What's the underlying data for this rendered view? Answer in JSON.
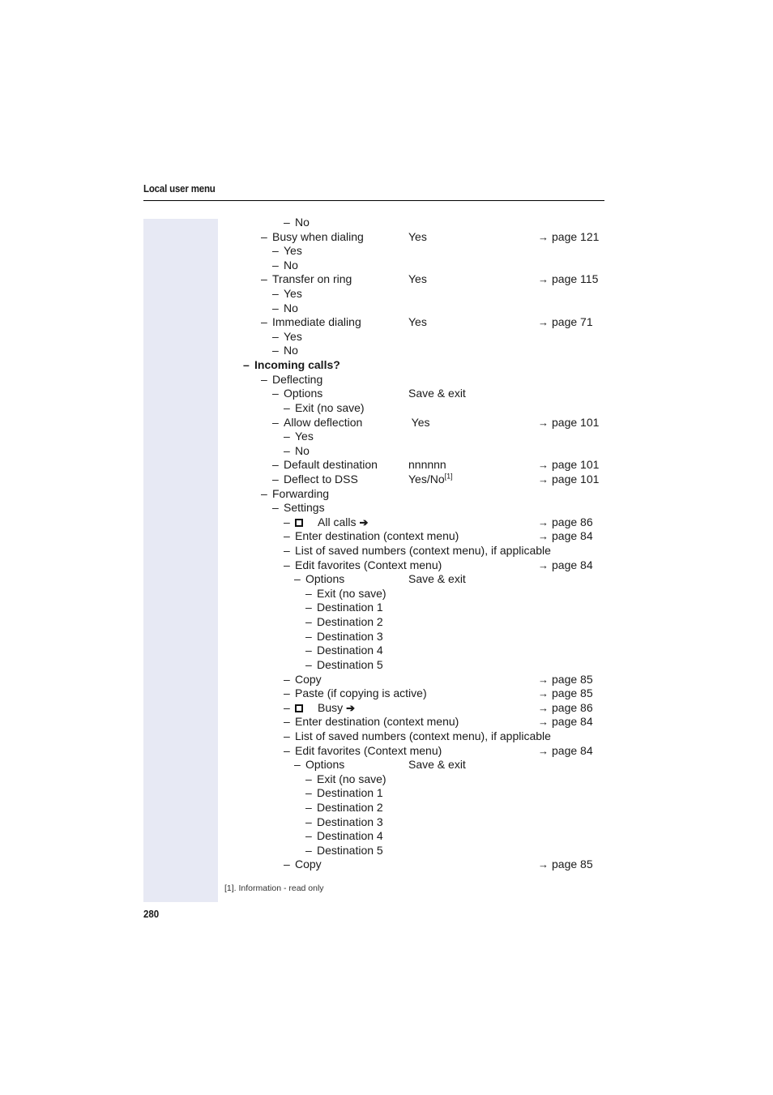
{
  "header": {
    "title": "Local user menu"
  },
  "rows": [
    {
      "level": 4,
      "label": "No"
    },
    {
      "level": 2,
      "label": "Busy when dialing",
      "value": "Yes",
      "ref": "page 121"
    },
    {
      "level": 3,
      "label": "Yes"
    },
    {
      "level": 3,
      "label": "No"
    },
    {
      "level": 2,
      "label": "Transfer on ring",
      "value": "Yes",
      "ref": "page 115"
    },
    {
      "level": 3,
      "label": "Yes"
    },
    {
      "level": 3,
      "label": "No"
    },
    {
      "level": 2,
      "label": "Immediate dialing",
      "value": "Yes",
      "ref": "page 71"
    },
    {
      "level": 3,
      "label": "Yes"
    },
    {
      "level": 3,
      "label": "No"
    },
    {
      "level": 1,
      "label": "Incoming calls?",
      "bold": true
    },
    {
      "level": 2,
      "label": "Deflecting"
    },
    {
      "level": 3,
      "label": "Options",
      "value": "Save & exit"
    },
    {
      "level": 4,
      "label": "Exit (no save)"
    },
    {
      "level": 3,
      "label": "Allow deflection",
      "value": " Yes",
      "ref": "page 101"
    },
    {
      "level": 4,
      "label": "Yes"
    },
    {
      "level": 4,
      "label": "No"
    },
    {
      "level": 3,
      "label": "Default destination",
      "value": "nnnnnn",
      "ref": "page 101"
    },
    {
      "level": 3,
      "label": "Deflect to DSS",
      "value": "Yes/No",
      "value_sup": "[1]",
      "ref": "page 101"
    },
    {
      "level": 2,
      "label": "Forwarding"
    },
    {
      "level": 3,
      "label": "Settings"
    },
    {
      "level": 4,
      "label": "All calls",
      "key_icon": true,
      "ref": "page 86"
    },
    {
      "level": 4,
      "label": "Enter destination (context menu)",
      "ref": "page 84"
    },
    {
      "level": 4,
      "label": "List of saved numbers (context menu), if applicable"
    },
    {
      "level": 4,
      "label": "Edit favorites (Context menu)",
      "ref": "page 84"
    },
    {
      "level": 5,
      "label": "Options",
      "value": "Save & exit"
    },
    {
      "level": 6,
      "label": "Exit (no save)"
    },
    {
      "level": 6,
      "label": "Destination 1"
    },
    {
      "level": 6,
      "label": "Destination 2"
    },
    {
      "level": 6,
      "label": "Destination 3"
    },
    {
      "level": 6,
      "label": "Destination 4"
    },
    {
      "level": 6,
      "label": "Destination 5"
    },
    {
      "level": 4,
      "label": "Copy",
      "ref": "page 85"
    },
    {
      "level": 4,
      "label": "Paste (if copying is active)",
      "ref": "page 85"
    },
    {
      "level": 4,
      "label": "Busy",
      "key_icon": true,
      "ref": "page 86"
    },
    {
      "level": 4,
      "label": "Enter destination (context menu)",
      "ref": "page 84"
    },
    {
      "level": 4,
      "label": "List of saved numbers (context menu), if applicable"
    },
    {
      "level": 4,
      "label": "Edit favorites (Context menu)",
      "ref": "page 84"
    },
    {
      "level": 5,
      "label": "Options",
      "value": "Save & exit"
    },
    {
      "level": 6,
      "label": "Exit (no save)"
    },
    {
      "level": 6,
      "label": "Destination 1"
    },
    {
      "level": 6,
      "label": "Destination 2"
    },
    {
      "level": 6,
      "label": "Destination 3"
    },
    {
      "level": 6,
      "label": "Destination 4"
    },
    {
      "level": 6,
      "label": "Destination 5"
    },
    {
      "level": 4,
      "label": "Copy",
      "ref": "page 85"
    }
  ],
  "symbols": {
    "dash": "–",
    "ref_arrow": "→",
    "key_arrow": "➔"
  },
  "footnote": "[1]. Information - read only",
  "page_number": "280",
  "colors": {
    "sidebar": "#e7e9f4",
    "text": "#1a1a1a"
  }
}
